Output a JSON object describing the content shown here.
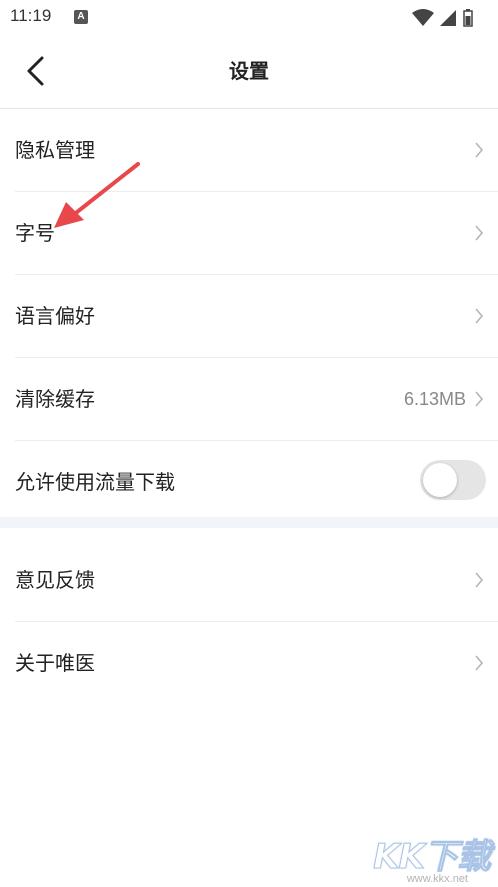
{
  "status_bar": {
    "time": "11:19",
    "notification_badge": "A",
    "icons": [
      "wifi-icon",
      "signal-icon",
      "battery-icon"
    ]
  },
  "header": {
    "title": "设置",
    "back_icon": "chevron-left-icon"
  },
  "settings": {
    "group1": [
      {
        "label": "隐私管理",
        "value": "",
        "control": "chevron"
      },
      {
        "label": "字号",
        "value": "",
        "control": "chevron"
      },
      {
        "label": "语言偏好",
        "value": "",
        "control": "chevron"
      },
      {
        "label": "清除缓存",
        "value": "6.13MB",
        "control": "chevron"
      },
      {
        "label": "允许使用流量下载",
        "value": "",
        "control": "toggle",
        "toggle_on": false
      }
    ],
    "group2": [
      {
        "label": "意见反馈",
        "value": "",
        "control": "chevron"
      },
      {
        "label": "关于唯医",
        "value": "",
        "control": "chevron"
      }
    ]
  },
  "annotation": {
    "arrow_color": "#e8474c",
    "arrow_target": "字号"
  },
  "watermark": {
    "brand": "KK下载",
    "url": "www.kkx.net"
  },
  "colors": {
    "divider": "#ececec",
    "section_gap": "#f1f4f8",
    "text_primary": "#222222",
    "text_secondary": "#888888",
    "toggle_off": "#e5e5e5"
  }
}
